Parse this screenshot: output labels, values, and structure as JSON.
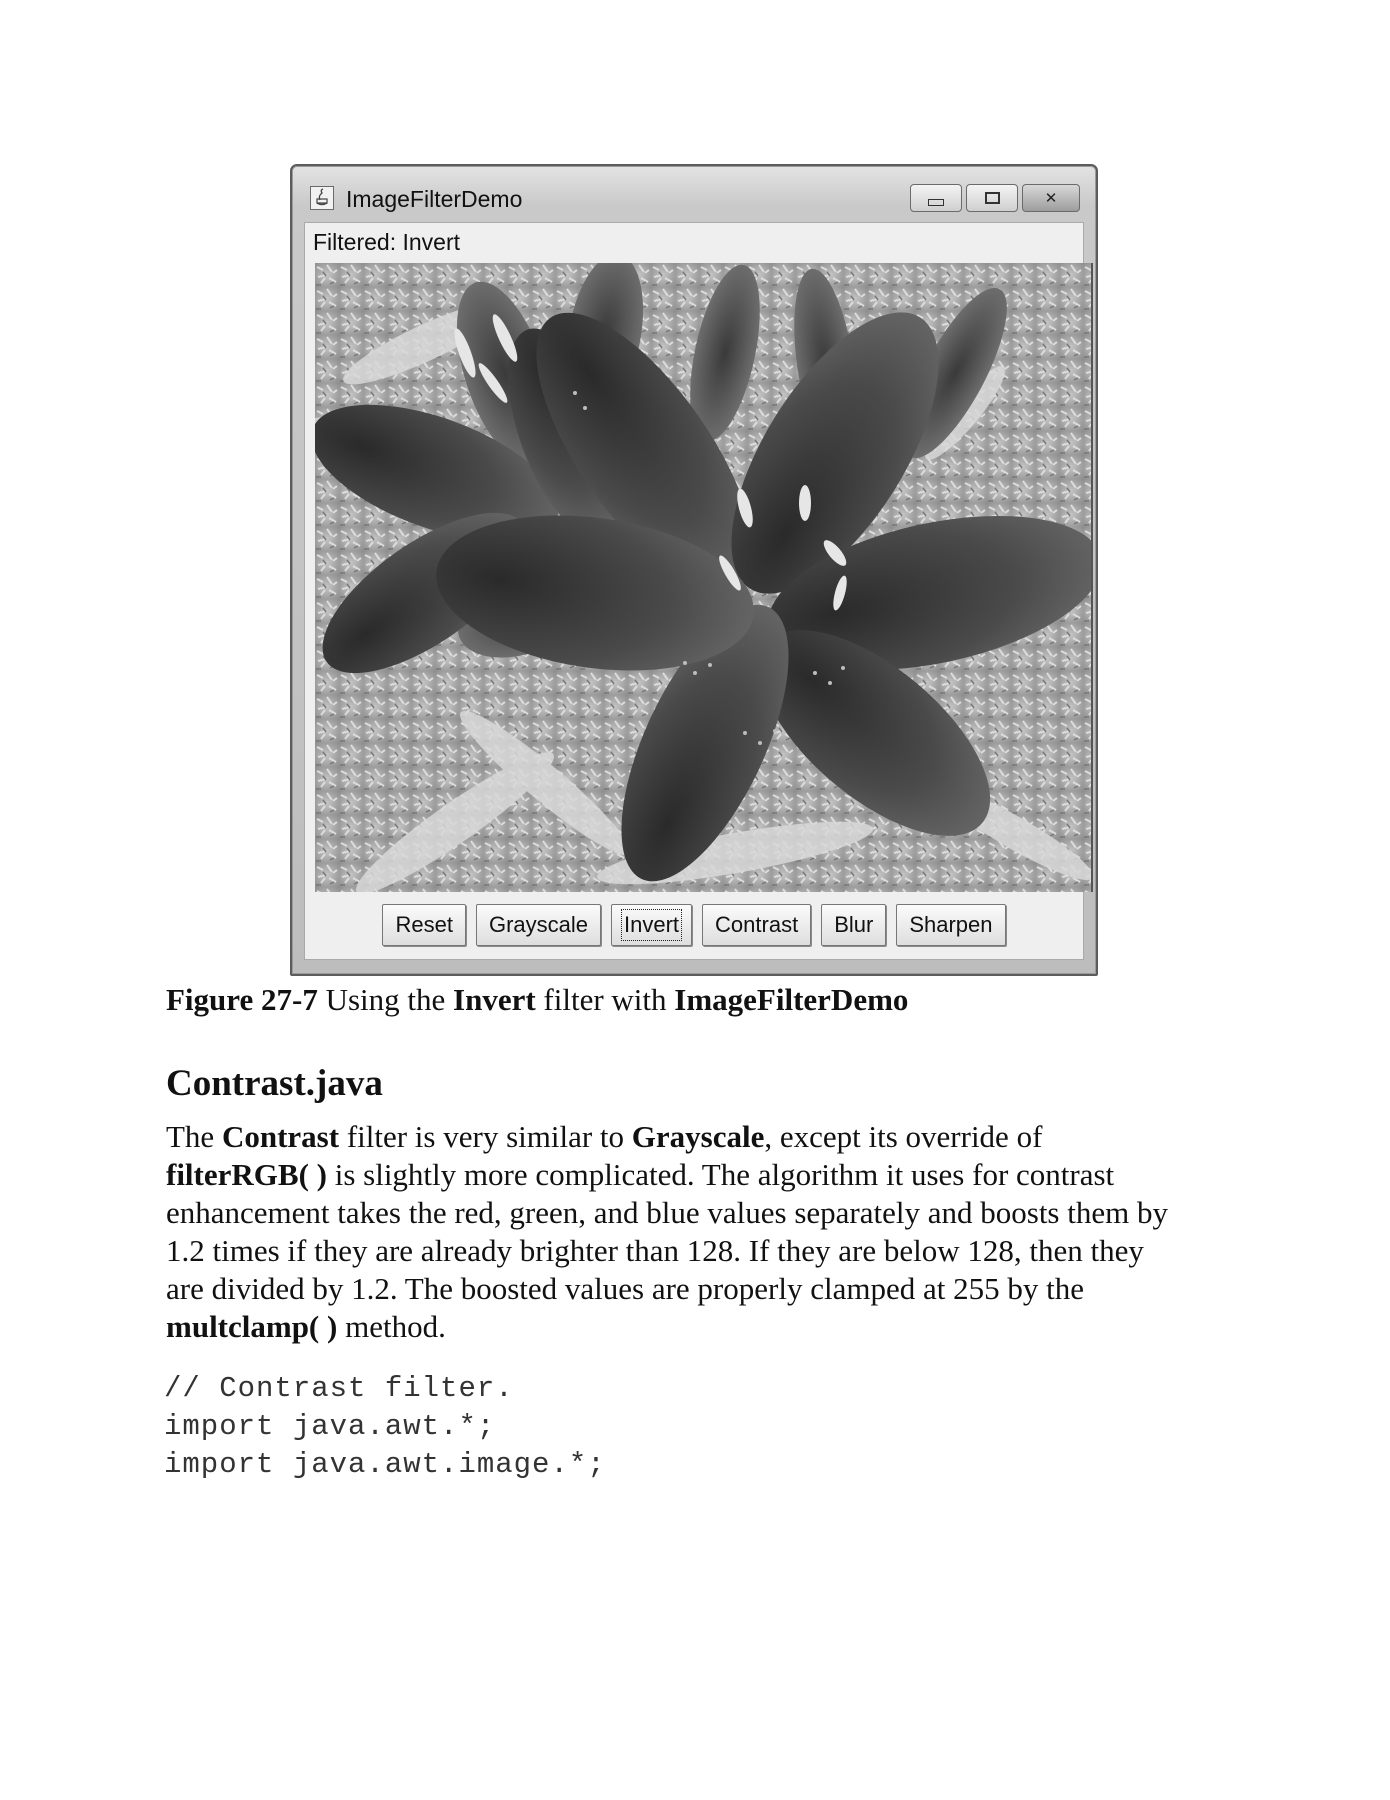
{
  "figure": {
    "window_title": "ImageFilterDemo",
    "status_label": "Filtered: Invert",
    "window_buttons": [
      "minimize",
      "maximize",
      "close"
    ],
    "buttons": [
      "Reset",
      "Grayscale",
      "Invert",
      "Contrast",
      "Blur",
      "Sharpen"
    ],
    "focused_button": "Invert",
    "image_description_icon": "inverted-lily-photo"
  },
  "caption": {
    "label": "Figure 27-7",
    "text1": " Using the ",
    "bold1": "Invert",
    "text2": " filter with ",
    "bold2": "ImageFilterDemo"
  },
  "section": {
    "heading": "Contrast.java",
    "paragraph": {
      "l1_a": "The ",
      "l1_b": "Contrast",
      "l1_c": " filter is very similar to ",
      "l1_d": "Grayscale",
      "l1_e": ", except its override of",
      "l2_a": "filterRGB( )",
      "l2_b": " is slightly more complicated. The algorithm it uses for contrast",
      "l3": "enhancement takes the red, green, and blue values separately and boosts them by",
      "l4": "1.2 times if they are already brighter than 128. If they are below 128, then they",
      "l5": "are divided by 1.2. The boosted values are properly clamped at 255 by the",
      "l6_a": "multclamp( )",
      "l6_b": " method."
    }
  },
  "code": [
    "// Contrast filter.",
    "import java.awt.*;",
    "import java.awt.image.*;"
  ]
}
